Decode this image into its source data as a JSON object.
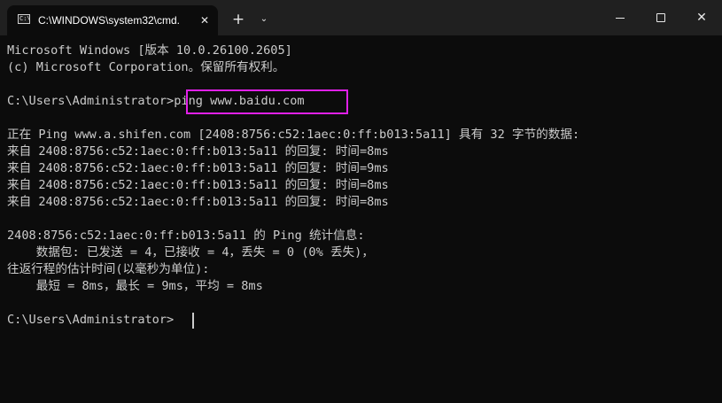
{
  "tab": {
    "title": "C:\\WINDOWS\\system32\\cmd.",
    "icon": "command-prompt-icon",
    "icon_glyph": "C:\\"
  },
  "titlebar": {
    "close_tab_icon": "✕",
    "new_tab_icon": "+",
    "dropdown_icon": "⌄",
    "close_window_icon": "✕"
  },
  "console": {
    "lines": [
      "Microsoft Windows [版本 10.0.26100.2605]",
      "(c) Microsoft Corporation。保留所有权利。",
      "",
      "",
      "",
      "正在 Ping www.a.shifen.com [2408:8756:c52:1aec:0:ff:b013:5a11] 具有 32 字节的数据:",
      "来自 2408:8756:c52:1aec:0:ff:b013:5a11 的回复: 时间=8ms",
      "来自 2408:8756:c52:1aec:0:ff:b013:5a11 的回复: 时间=9ms",
      "来自 2408:8756:c52:1aec:0:ff:b013:5a11 的回复: 时间=8ms",
      "来自 2408:8756:c52:1aec:0:ff:b013:5a11 的回复: 时间=8ms",
      "",
      "2408:8756:c52:1aec:0:ff:b013:5a11 的 Ping 统计信息:",
      "    数据包: 已发送 = 4，已接收 = 4，丢失 = 0 (0% 丢失)，",
      "往返行程的估计时间(以毫秒为单位):",
      "    最短 = 8ms，最长 = 9ms，平均 = 8ms",
      ""
    ],
    "prompt": "C:\\Users\\Administrator>",
    "command": "ping www.baidu.com",
    "final_prompt": "C:\\Users\\Administrator>"
  },
  "colors": {
    "background": "#0c0c0c",
    "titlebar": "#202020",
    "text": "#cccccc",
    "highlight_border": "#e020e8"
  }
}
